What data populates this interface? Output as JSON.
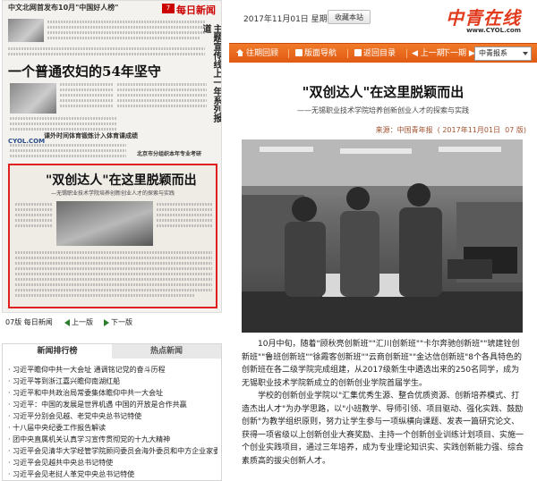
{
  "left": {
    "paper": {
      "header_line": "中文北网首发布10月\"中国好人榜\"",
      "masthead": "每日新闻",
      "page_no": "7",
      "side_title": "主题宣传线上一年系列报道",
      "lead_headline": "一个普通农妇的54年坚守",
      "sub_item_1": "课外时间体育锻炼计入体育课成绩",
      "sub_item_2": "北京市分组织本年专业考研",
      "logo": "CYOL.COM",
      "highlight_title": "\"双创达人\"在这里脱颖而出",
      "highlight_subtitle": "—无锡职业技术学院培养创新创业人才的探索与实践"
    },
    "pager": {
      "edition": "07版 每日新闻",
      "prev": "上一版",
      "next": "下一版"
    },
    "rank": {
      "tab_active": "新闻排行榜",
      "tab_inactive": "热点新闻",
      "items": [
        "· 习近平瞻仰中共一大会址 通调铭记党的奋斗历程",
        "· 习近平等到浙江嘉兴瞻仰南湖红船",
        "· 习近平和中共政治局常委集体瞻仰中共一大会址",
        "· 习近平：中国的发展是世界机遇 中国的开放是合作共赢",
        "· 习近平分别会见越、老党中央总书记特使",
        "· 十八届中央纪委工作报告解读",
        "· 团中央直属机关认真学习宣传贯彻党的十九大精神",
        "· 习近平会见清华大学经管学院顾问委员会海外委员和中方企业家委员",
        "· 习近平会见越共中央总书记特使",
        "· 习近平会见老挝人革党中央总书记特使"
      ]
    }
  },
  "right": {
    "topbar": {
      "date": "2017年11月01日  星期三",
      "favorite_label": "收藏本站",
      "brand": "中青在线",
      "brand_url": "www.CYOL.com"
    },
    "nav": {
      "items": [
        "往期回顾",
        "版面导航",
        "返回目录",
        "上一期",
        "下一期"
      ],
      "select_value": "中青报系"
    },
    "article": {
      "title": "\"双创达人\"在这里脱颖而出",
      "subtitle": "——无锡职业技术学院培养创新创业人才的探索与实践",
      "source": "来源：中国青年报",
      "source_date": "( 2017年11月01日",
      "source_page": "07 版)",
      "paragraphs": [
        "10月中旬，随着\"顾秋亮创新班\"\"汇川创新班\"\"卡尔奔驰创新班\"\"琥建铨创新班\"\"鲁班创新班\"\"徐霞客创新班\"\"云商创新班\"\"金达信创新班\"8个各具特色的创新班在各二级学院完成组建，从2017级新生中遴选出来的250名同学，成为无锡职业技术学院新成立的创新创业学院首届学生。",
        "学校的创新创业学院以\"汇集优秀生源、整合优质资源、创新培养模式、打造杰出人才\"为办学思路，以\"小班教学、导师引领、项目驱动、强化实践、鼓励创新\"为教学组织原则，努力让学生参与一项纵横向课题、发表一篇研究论文、获得一项省级以上创新创业大赛奖励、主持一个创新创业训练计划项目、实施一个创业实践项目，通过三年培养，成为专业理论知识实、实践创新能力强、综合素质高的拔尖创新人才。"
      ]
    }
  }
}
